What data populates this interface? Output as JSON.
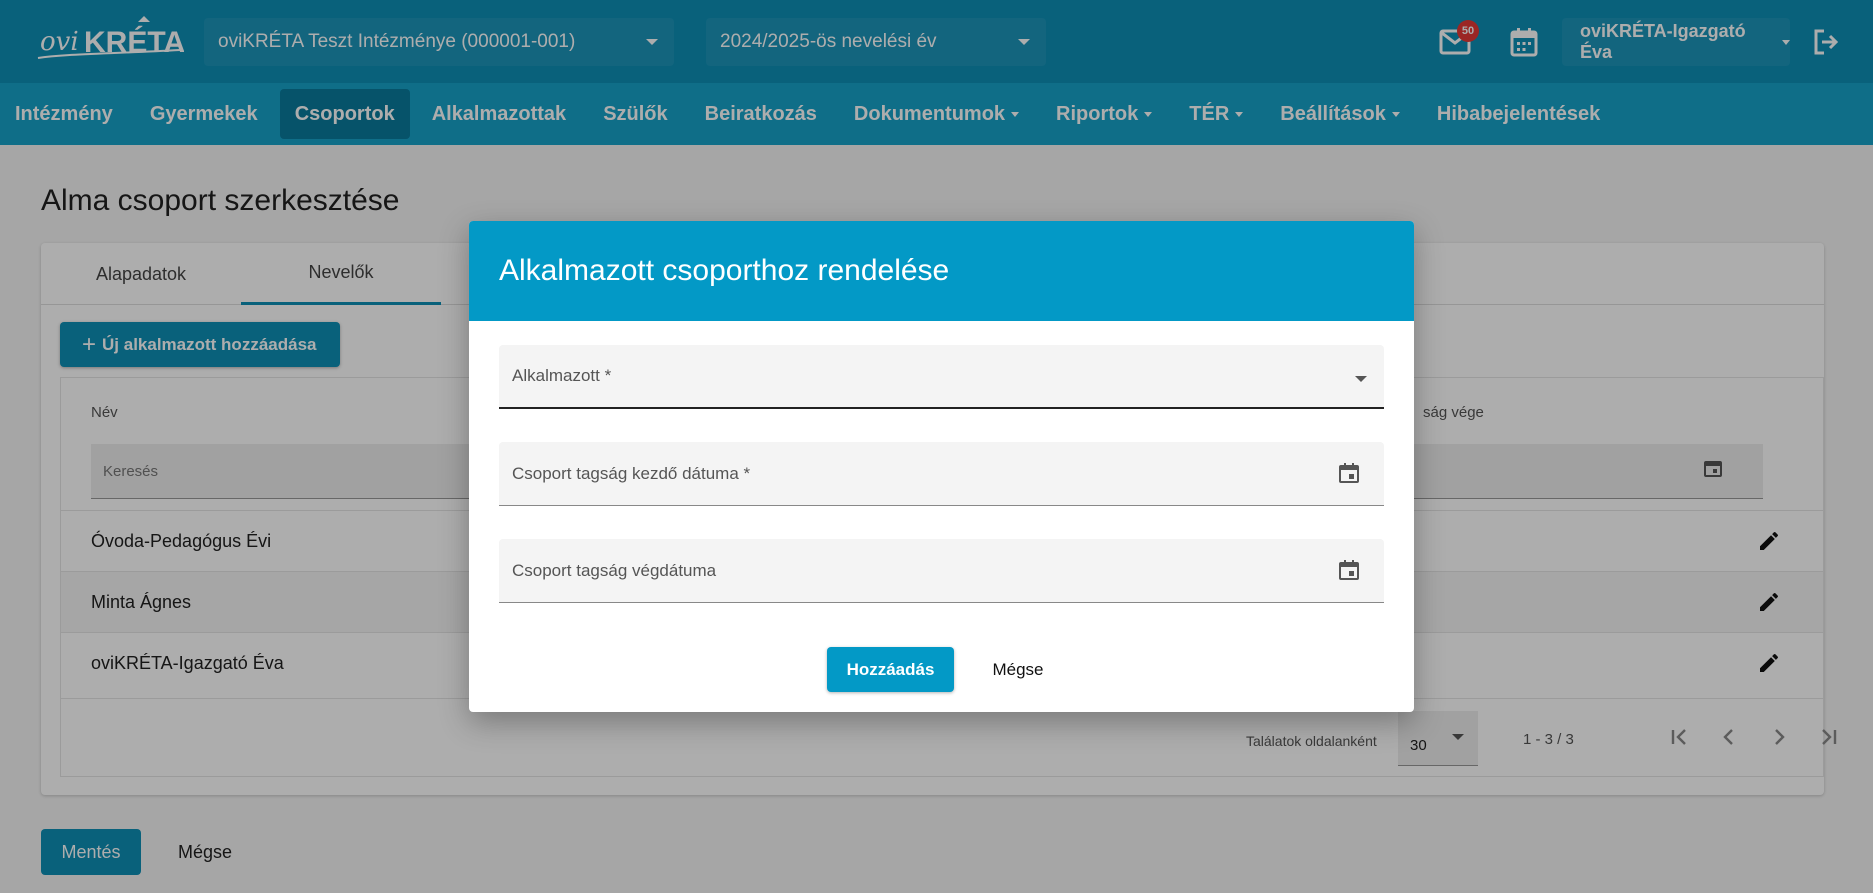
{
  "header": {
    "logo_text": "oviKRÉTA",
    "institution": "oviKRÉTA Teszt Intézménye (000001-001)",
    "school_year": "2024/2025-ös nevelési év",
    "mail_badge": "50",
    "user": "oviKRÉTA-Igazgató Éva"
  },
  "nav": {
    "items": [
      {
        "label": "Intézmény"
      },
      {
        "label": "Gyermekek"
      },
      {
        "label": "Csoportok"
      },
      {
        "label": "Alkalmazottak"
      },
      {
        "label": "Szülők"
      },
      {
        "label": "Beiratkozás"
      },
      {
        "label": "Dokumentumok"
      },
      {
        "label": "Riportok"
      },
      {
        "label": "TÉR"
      },
      {
        "label": "Beállítások"
      },
      {
        "label": "Hibabejelentések"
      }
    ]
  },
  "page": {
    "title": "Alma csoport szerkesztése",
    "tabs": [
      "Alapadatok",
      "Nevelők"
    ],
    "add_button": "Új alkalmazott hozzáadása",
    "col_name": "Név",
    "col_end_partial": "ság vége",
    "search_placeholder": "Keresés",
    "rows": [
      "Óvoda-Pedagógus Évi",
      "Minta Ágnes",
      "oviKRÉTA-Igazgató Éva"
    ],
    "per_page_label": "Találatok oldalanként",
    "per_page_value": "30",
    "range": "1 - 3 / 3",
    "save": "Mentés",
    "cancel": "Mégse"
  },
  "modal": {
    "title": "Alkalmazott csoporthoz rendelése",
    "employee_label": "Alkalmazott *",
    "start_label": "Csoport tagság kezdő dátuma *",
    "end_label": "Csoport tagság végdátuma",
    "add": "Hozzáadás",
    "cancel": "Mégse"
  },
  "colors": {
    "primary": "#0e8fb6",
    "nav": "#17a2c9",
    "modal_header": "#0399c6",
    "badge": "#e53935"
  }
}
